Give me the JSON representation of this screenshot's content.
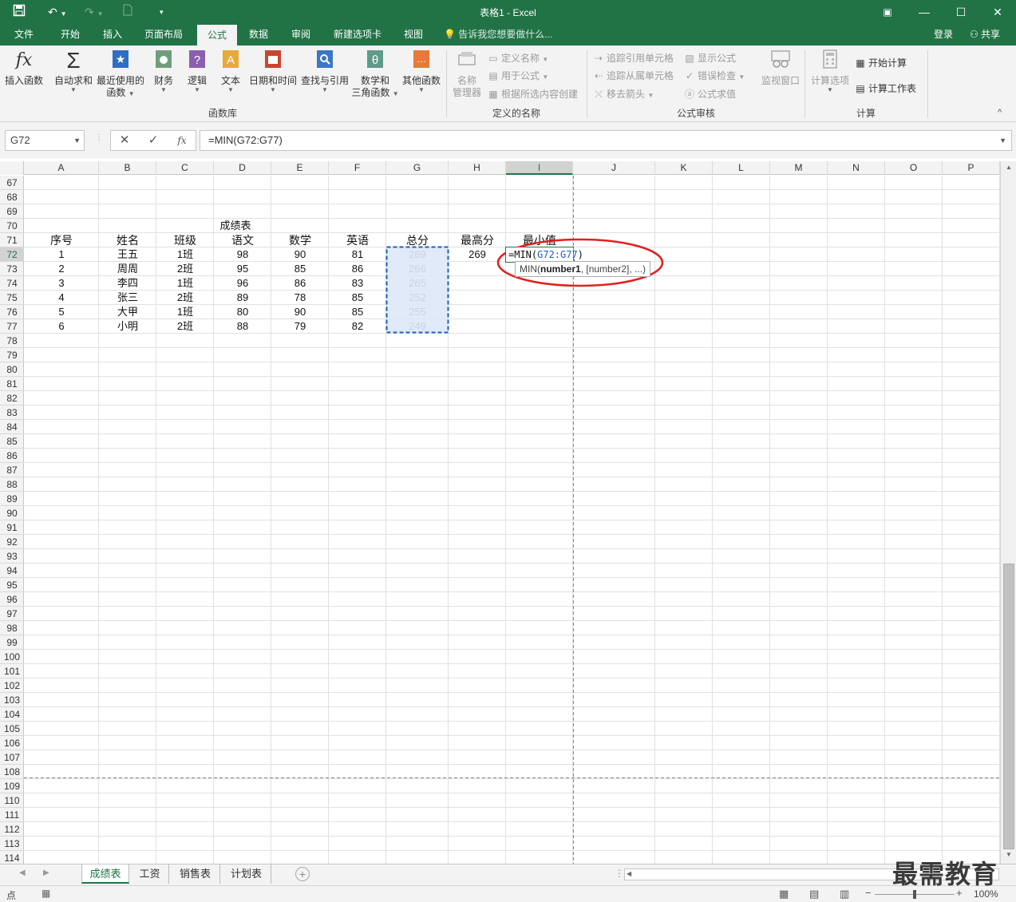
{
  "titlebar": {
    "title": "表格1 - Excel",
    "save_icon": "save-icon",
    "undo_icon": "undo-icon",
    "redo_icon": "redo-icon"
  },
  "tabs": [
    {
      "label": "文件"
    },
    {
      "label": "开始"
    },
    {
      "label": "插入"
    },
    {
      "label": "页面布局"
    },
    {
      "label": "公式"
    },
    {
      "label": "数据"
    },
    {
      "label": "审阅"
    },
    {
      "label": "新建选项卡"
    },
    {
      "label": "视图"
    }
  ],
  "tell_me": "告诉我您想要做什么...",
  "signin": "登录",
  "share": "共享",
  "ribbon": {
    "library": {
      "buttons": [
        {
          "label": "插入函数",
          "label2": ""
        },
        {
          "label": "自动求和",
          "label2": ""
        },
        {
          "label": "最近使用的",
          "label2": "函数"
        },
        {
          "label": "财务",
          "label2": ""
        },
        {
          "label": "逻辑",
          "label2": ""
        },
        {
          "label": "文本",
          "label2": ""
        },
        {
          "label": "日期和时间",
          "label2": ""
        },
        {
          "label": "查找与引用",
          "label2": ""
        },
        {
          "label": "数学和",
          "label2": "三角函数"
        },
        {
          "label": "其他函数",
          "label2": ""
        }
      ],
      "group_label": "函数库"
    },
    "names": {
      "manager_label1": "名称",
      "manager_label2": "管理器",
      "define": "定义名称",
      "use_in_formula": "用于公式",
      "create_from_selection": "根据所选内容创建",
      "group_label": "定义的名称"
    },
    "audit": {
      "trace_precedents": "追踪引用单元格",
      "trace_dependents": "追踪从属单元格",
      "remove_arrows": "移去箭头",
      "show_formulas": "显示公式",
      "error_checking": "错误检查",
      "evaluate": "公式求值",
      "watch": "监视窗口",
      "group_label": "公式审核"
    },
    "calc": {
      "options": "计算选项",
      "calc_now": "开始计算",
      "calc_sheet": "计算工作表",
      "group_label": "计算"
    }
  },
  "formula_bar": {
    "name_box": "G72",
    "formula": "=MIN(G72:G77)"
  },
  "columns": [
    "A",
    "B",
    "C",
    "D",
    "E",
    "F",
    "G",
    "H",
    "I",
    "J",
    "K",
    "L",
    "M",
    "N",
    "O",
    "P"
  ],
  "selected_column": "I",
  "rows": [
    "67",
    "68",
    "69",
    "70",
    "71",
    "72",
    "73",
    "74",
    "75",
    "76",
    "77",
    "78",
    "79",
    "80",
    "81",
    "82",
    "83",
    "84",
    "85",
    "86",
    "87",
    "88",
    "89",
    "90",
    "91",
    "92",
    "93",
    "94",
    "95",
    "96",
    "97",
    "98",
    "99",
    "100",
    "101",
    "102",
    "103",
    "104",
    "105",
    "106",
    "107",
    "108",
    "109",
    "110",
    "111",
    "112",
    "113",
    "114"
  ],
  "selected_row": "72",
  "sheet": {
    "title": "成绩表",
    "headers": [
      "序号",
      "姓名",
      "班级",
      "语文",
      "数学",
      "英语",
      "总分",
      "最高分",
      "最小值"
    ],
    "data": [
      [
        "1",
        "王五",
        "1班",
        "98",
        "90",
        "81",
        "269"
      ],
      [
        "2",
        "周周",
        "2班",
        "95",
        "85",
        "86",
        "266"
      ],
      [
        "3",
        "李四",
        "1班",
        "96",
        "86",
        "83",
        "265"
      ],
      [
        "4",
        "张三",
        "2班",
        "89",
        "78",
        "85",
        "252"
      ],
      [
        "5",
        "大甲",
        "1班",
        "80",
        "90",
        "85",
        "255"
      ],
      [
        "6",
        "小明",
        "2班",
        "88",
        "79",
        "82",
        "249"
      ]
    ],
    "max_value": "269",
    "edit_prefix": "=MIN(",
    "edit_ref": "G72:G77",
    "edit_suffix": ")",
    "tooltip_fn": "MIN(",
    "tooltip_arg1": "number1",
    "tooltip_rest": ", [number2], ...)"
  },
  "sheet_tabs": [
    {
      "label": "成绩表",
      "active": true
    },
    {
      "label": "工资",
      "active": false
    },
    {
      "label": "销售表",
      "active": false
    },
    {
      "label": "计划表",
      "active": false
    }
  ],
  "status": {
    "mode": "点",
    "zoom": "100%"
  },
  "watermark": "最需教育",
  "colors": {
    "excel_green": "#217346",
    "ref_blue": "#1f5fbf",
    "annotation_red": "#e02020"
  }
}
